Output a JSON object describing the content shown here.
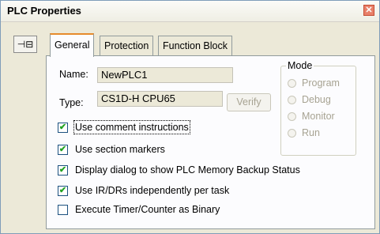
{
  "window": {
    "title": "PLC Properties",
    "close_glyph": "✕"
  },
  "pin_glyph": "⊣⊟",
  "tabs": [
    {
      "label": "General",
      "active": true
    },
    {
      "label": "Protection",
      "active": false
    },
    {
      "label": "Function Block",
      "active": false
    }
  ],
  "general": {
    "name_label": "Name:",
    "name_value": "NewPLC1",
    "type_label": "Type:",
    "type_value": "CS1D-H CPU65",
    "verify_label": "Verify"
  },
  "mode": {
    "title": "Mode",
    "options": [
      {
        "label": "Program"
      },
      {
        "label": "Debug"
      },
      {
        "label": "Monitor"
      },
      {
        "label": "Run"
      }
    ]
  },
  "checkboxes": [
    {
      "label": "Use comment instructions",
      "checked": true
    },
    {
      "label": "Use section markers",
      "checked": true
    },
    {
      "label": "Display dialog to show PLC Memory Backup Status",
      "checked": true
    },
    {
      "label": "Use IR/DRs independently per task",
      "checked": true
    },
    {
      "label": "Execute Timer/Counter as Binary",
      "checked": false
    }
  ],
  "check_glyph": "✔",
  "colors": {
    "accent_tab": "#e68b2c",
    "close_button": "#e8806a",
    "check": "#21a121"
  }
}
